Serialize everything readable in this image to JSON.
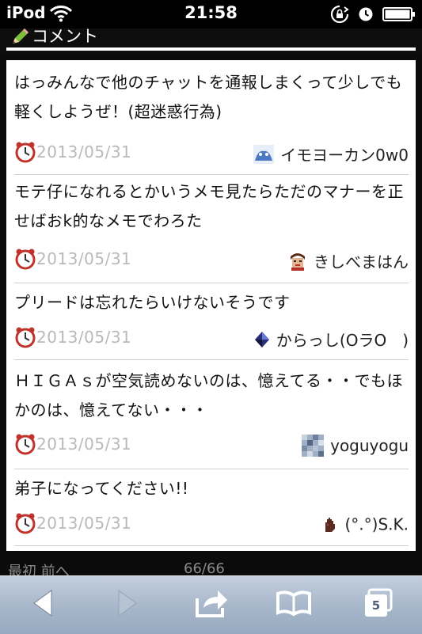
{
  "status_bar": {
    "carrier": "iPod",
    "time": "21:58",
    "icons": [
      "wifi-icon",
      "rotation-lock-icon",
      "alarm-clock-icon",
      "battery-icon"
    ]
  },
  "section": {
    "title": "コメント",
    "icon": "pencil-icon"
  },
  "comments": [
    {
      "text": "はっみんなで他のチャットを通報しまくって少しでも軽くしようぜ！(超迷惑行為)",
      "date": "2013/05/31",
      "author": "イモヨーカン0w0",
      "avatar": "avatar-blue-blob-icon"
    },
    {
      "text": "モテ仔になれるとかいうメモ見たらただのマナーを正せばおk的なメモでわろた",
      "date": "2013/05/31",
      "author": "きしべまはん",
      "avatar": "avatar-character-icon"
    },
    {
      "text": "プリードは忘れたらいけないそうです",
      "date": "2013/05/31",
      "author": "からっし(OラO　)",
      "avatar": "avatar-diamond-icon"
    },
    {
      "text": "ＨＩＧＡｓが空気読めないのは、憶えてる・・でもほかのは、憶えてない・・・",
      "date": "2013/05/31",
      "author": "yoguyogu",
      "avatar": "avatar-pixel-icon"
    },
    {
      "text": "弟子になってください!!",
      "date": "2013/05/31",
      "author": "(°.°)S.K.",
      "avatar": "avatar-hand-icon"
    }
  ],
  "pager": {
    "first_prev": "最初 前へ",
    "count": "66/66"
  },
  "toolbar": {
    "tabs_count": "5",
    "buttons": [
      "back-icon",
      "forward-icon",
      "share-icon",
      "bookmarks-icon",
      "tabs-icon"
    ]
  },
  "colors": {
    "date_text": "#b9b9b9",
    "toolbar_top": "#c3cfdd",
    "toolbar_bottom": "#97a9bf",
    "page_bg": "#0b0b0b"
  }
}
